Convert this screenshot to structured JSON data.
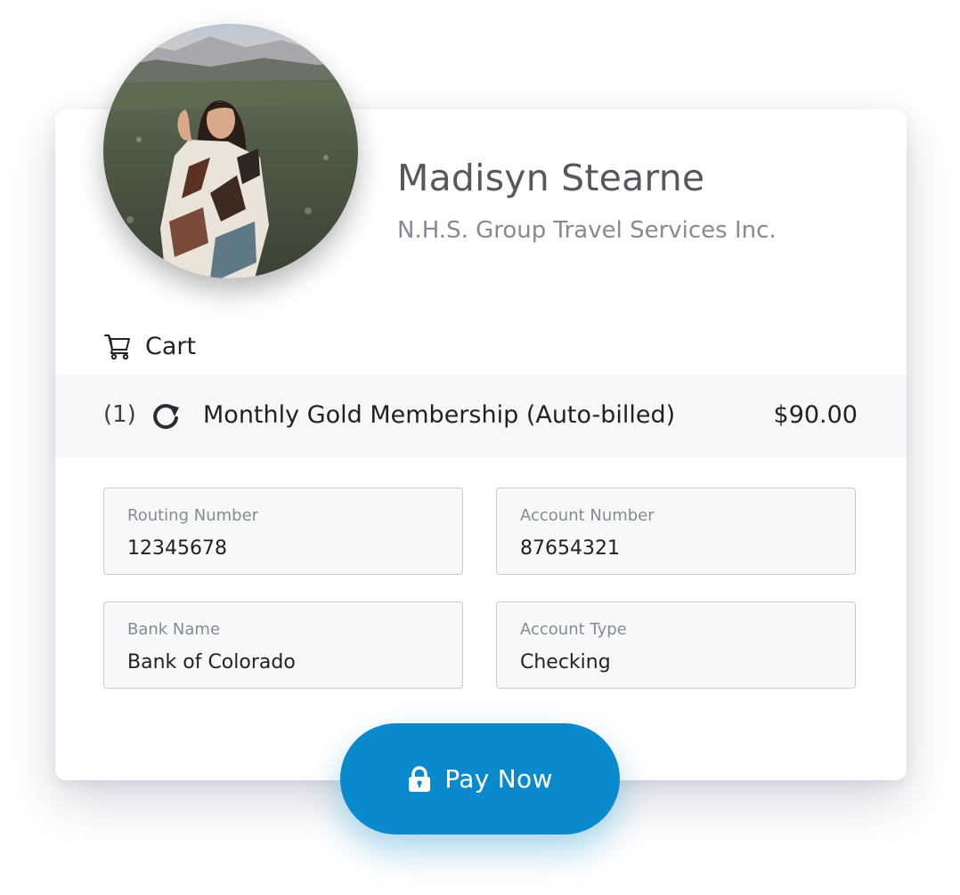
{
  "profile": {
    "name": "Madisyn Stearne",
    "company": "N.H.S. Group Travel Services Inc.",
    "avatar_icon": "profile-photo"
  },
  "cart": {
    "label": "Cart",
    "icon": "cart-icon",
    "items": [
      {
        "quantity": "(1)",
        "icon": "recurring-icon",
        "name": "Monthly Gold Membership (Auto-billed)",
        "price": "$90.00"
      }
    ]
  },
  "form": {
    "routing_number": {
      "label": "Routing Number",
      "value": "12345678"
    },
    "account_number": {
      "label": "Account Number",
      "value": "87654321"
    },
    "bank_name": {
      "label": "Bank Name",
      "value": "Bank of Colorado"
    },
    "account_type": {
      "label": "Account Type",
      "value": "Checking"
    }
  },
  "pay_button": {
    "label": "Pay Now",
    "icon": "lock-icon"
  },
  "colors": {
    "accent": "#0a89cc",
    "card_background": "#ffffff",
    "line_item_background": "#f6f7f9",
    "field_background": "#f7f8fa",
    "field_border": "#c7cacf"
  }
}
